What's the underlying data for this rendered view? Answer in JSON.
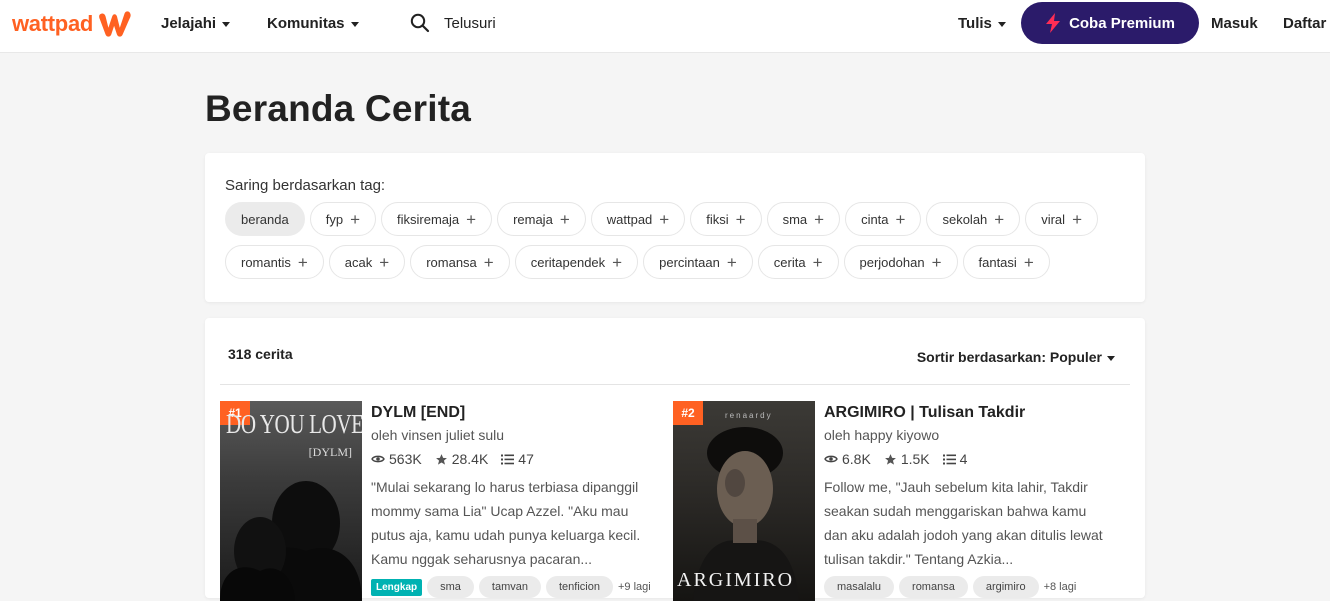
{
  "header": {
    "logo_text": "wattpad",
    "nav": [
      {
        "label": "Jelajahi"
      },
      {
        "label": "Komunitas"
      }
    ],
    "search_label": "Telusuri",
    "write_label": "Tulis",
    "premium_label": "Coba Premium",
    "login_label": "Masuk",
    "signup_label": "Daftar"
  },
  "page_title": "Beranda Cerita",
  "filter": {
    "label": "Saring berdasarkan tag:",
    "row1": [
      "beranda",
      "fyp",
      "fiksiremaja",
      "remaja",
      "wattpad",
      "fiksi",
      "sma",
      "cinta",
      "sekolah",
      "viral"
    ],
    "row2": [
      "romantis",
      "acak",
      "romansa",
      "ceritapendek",
      "percintaan",
      "cerita",
      "perjodohan",
      "fantasi"
    ]
  },
  "results": {
    "count": "318 cerita",
    "sort_label": "Sortir berdasarkan: Populer"
  },
  "stories": [
    {
      "rank": "#1",
      "cover_title": "DO YOU LOVE ME",
      "cover_sub": "[DYLM]",
      "title": "DYLM [END]",
      "author": "oleh vinsen juliet sulu",
      "reads": "563K",
      "votes": "28.4K",
      "parts": "47",
      "description": "\"Mulai sekarang lo harus terbiasa dipanggil mommy sama Lia\" Ucap Azzel. \"Aku mau putus aja, kamu udah punya keluarga kecil. Kamu nggak seharusnya pacaran...",
      "complete": "Lengkap",
      "tags": [
        "sma",
        "tamvan",
        "tenficion"
      ],
      "more": "+9 lagi"
    },
    {
      "rank": "#2",
      "cover_top": "renaardy",
      "cover_bottom": "ARGIMIRO",
      "title": "ARGIMIRO | Tulisan Takdir",
      "author": "oleh happy kiyowo",
      "reads": "6.8K",
      "votes": "1.5K",
      "parts": "4",
      "description": "Follow me, \"Jauh sebelum kita lahir, Takdir seakan sudah menggariskan bahwa kamu dan aku adalah jodoh yang akan ditulis lewat tulisan takdir.\" Tentang Azkia...",
      "tags": [
        "masalalu",
        "romansa",
        "argimiro"
      ],
      "more": "+8 lagi"
    }
  ],
  "colors": {
    "brand": "#ff6122",
    "premium": "#2b1b6a",
    "complete_badge": "#00b2b2"
  }
}
